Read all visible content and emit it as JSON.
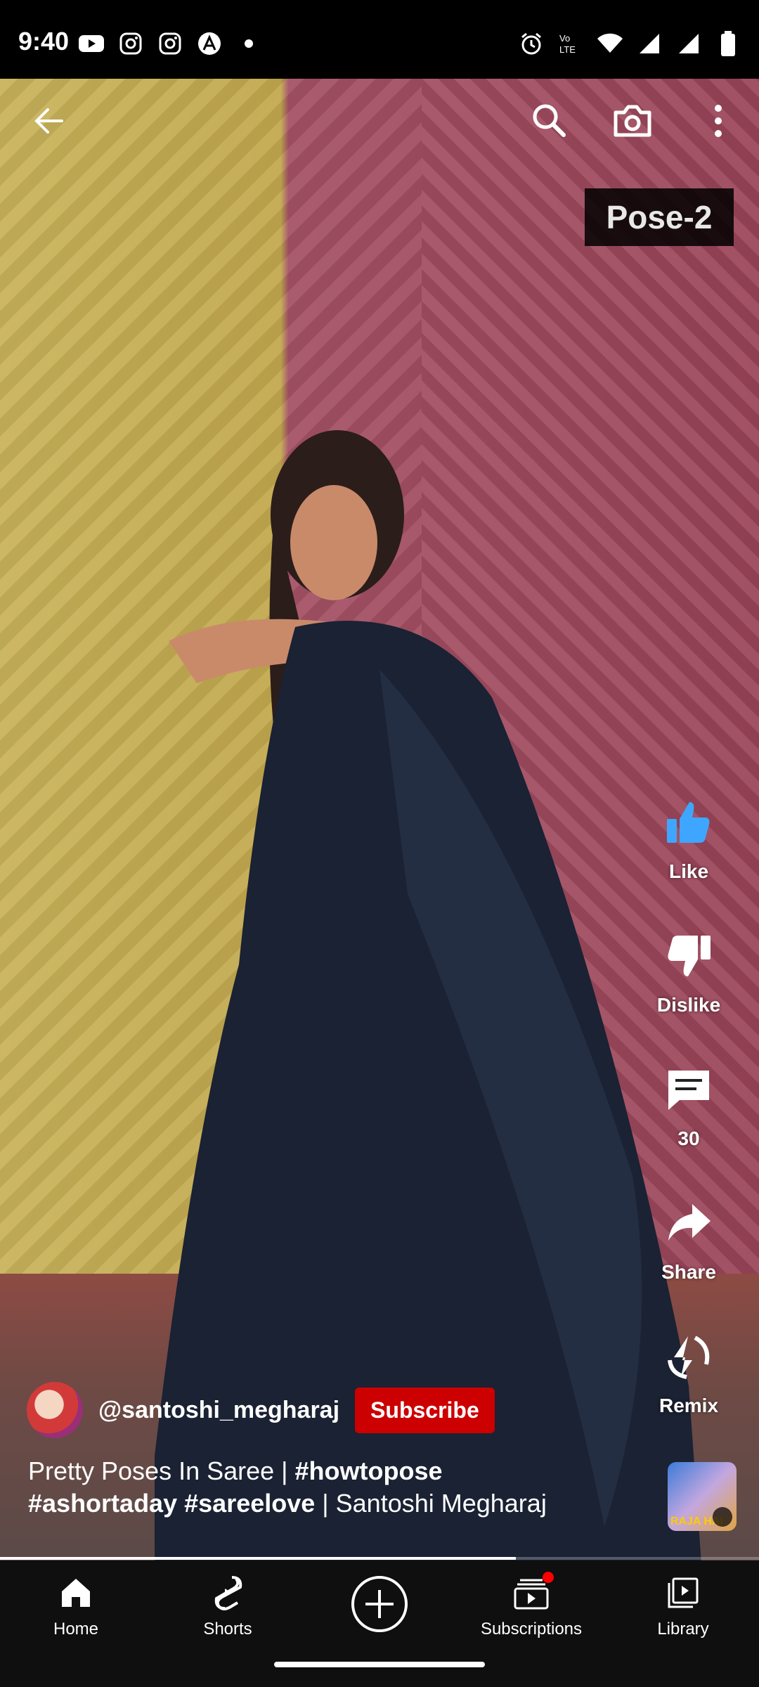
{
  "status_bar": {
    "time": "9:40",
    "left_icons": [
      "youtube-icon",
      "instagram-icon",
      "instagram-icon",
      "app-icon",
      "dot-icon"
    ],
    "right_icons": [
      "alarm-icon",
      "volte-icon",
      "wifi-icon",
      "signal-icon",
      "signal-icon",
      "battery-icon"
    ]
  },
  "video": {
    "caption_overlay": "Pose-2"
  },
  "actions": {
    "like": "Like",
    "dislike": "Dislike",
    "comments": "30",
    "share": "Share",
    "remix": "Remix"
  },
  "channel": {
    "handle": "@santoshi_megharaj",
    "subscribe": "Subscribe"
  },
  "title": {
    "part1": "Pretty Poses In Saree | ",
    "tag1": "#howtopose",
    "tag2": "#ashortaday",
    "tag3": "#sareelove",
    "part2": " | Santoshi Megharaj"
  },
  "sound": {
    "thumb_text": "RAJA HAI"
  },
  "playback": {
    "progress_percent": 68
  },
  "nav": {
    "home": "Home",
    "shorts": "Shorts",
    "subscriptions": "Subscriptions",
    "library": "Library"
  },
  "colors": {
    "accent": "#cc0000",
    "like_active": "#3ea6ff",
    "nav_bg": "#0f0f0f"
  }
}
